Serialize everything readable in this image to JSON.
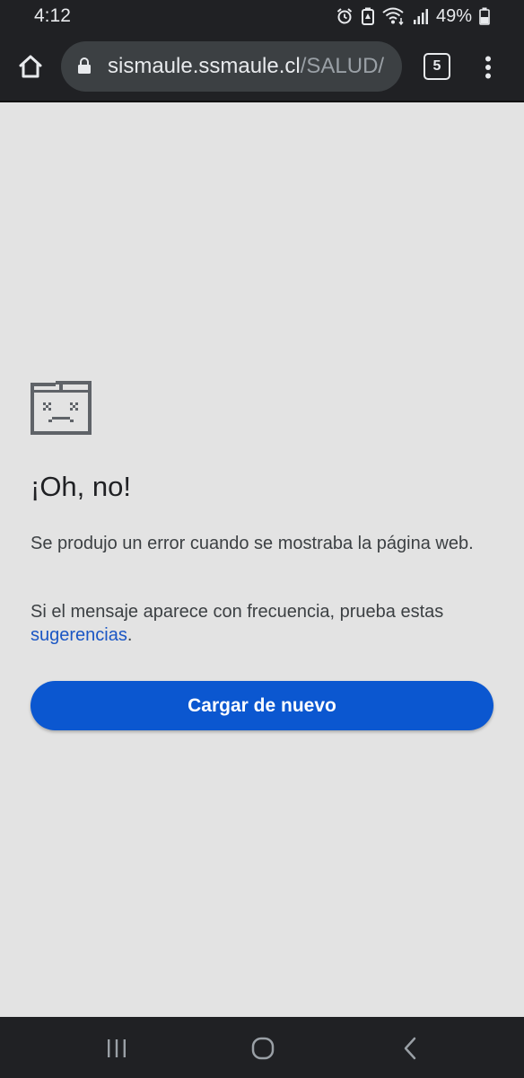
{
  "status_bar": {
    "time": "4:12",
    "battery": "49%",
    "icons": [
      "alarm-icon",
      "battery-saver-icon",
      "wifi-icon",
      "signal-icon",
      "battery-icon"
    ]
  },
  "toolbar": {
    "url_host": "sismaule.ssmaule.cl",
    "url_path": "/SALUD/",
    "tab_count": "5",
    "icons": [
      "home-icon",
      "lock-icon",
      "more-vert-icon"
    ]
  },
  "error_page": {
    "icon": "sad-page-icon",
    "title": "¡Oh, no!",
    "message": "Se produjo un error cuando se mostraba la página web.",
    "suggestion_prefix": "Si el mensaje aparece con frecuencia, prueba estas ",
    "suggestion_link": "sugerencias",
    "suggestion_suffix": ".",
    "reload_label": "Cargar de nuevo"
  },
  "colors": {
    "chrome_bg": "#202124",
    "page_bg": "#e3e3e3",
    "accent": "#0b57d0",
    "link": "#1a56c4"
  },
  "nav_bar": {
    "icons": [
      "recents-icon",
      "home-circle-icon",
      "back-icon"
    ]
  }
}
